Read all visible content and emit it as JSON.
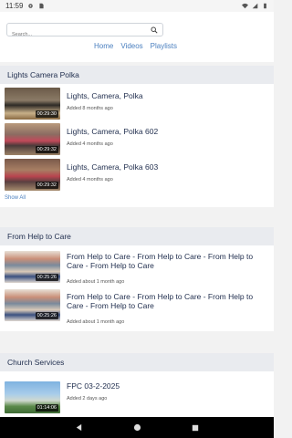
{
  "status": {
    "time": "11:59",
    "icons": [
      "gear-icon",
      "sim-icon",
      "wifi-icon",
      "signal-icon",
      "battery-icon"
    ]
  },
  "search": {
    "placeholder": "Search..."
  },
  "nav": {
    "home": "Home",
    "videos": "Videos",
    "playlists": "Playlists"
  },
  "sections": [
    {
      "title": "Lights Camera Polka",
      "items": [
        {
          "title": "Lights, Camera, Polka",
          "date": "Added 8 months ago",
          "duration": "00:29:30"
        },
        {
          "title": "Lights, Camera, Polka 602",
          "date": "Added 4 months ago",
          "duration": "00:29:32"
        },
        {
          "title": "Lights, Camera, Polka 603",
          "date": "Added 4 months ago",
          "duration": "00:29:32"
        }
      ],
      "show_all": "Show All"
    },
    {
      "title": "From Help to Care",
      "items": [
        {
          "title": "From Help to Care - From Help to Care - From Help to Care - From Help to Care",
          "date": "Added about 1 month ago",
          "duration": "00:25:26"
        },
        {
          "title": "From Help to Care - From Help to Care - From Help to Care - From Help to Care",
          "date": "Added about 1 month ago",
          "duration": "00:25:26"
        }
      ]
    },
    {
      "title": "Church Services",
      "items": [
        {
          "title": "FPC 03-2-2025",
          "date": "Added 2 days ago",
          "duration": "01:14:06"
        }
      ]
    }
  ],
  "colors": {
    "accent": "#4a7fbf",
    "title_text": "#1f2d4d",
    "section_bg": "#e9ebef"
  }
}
